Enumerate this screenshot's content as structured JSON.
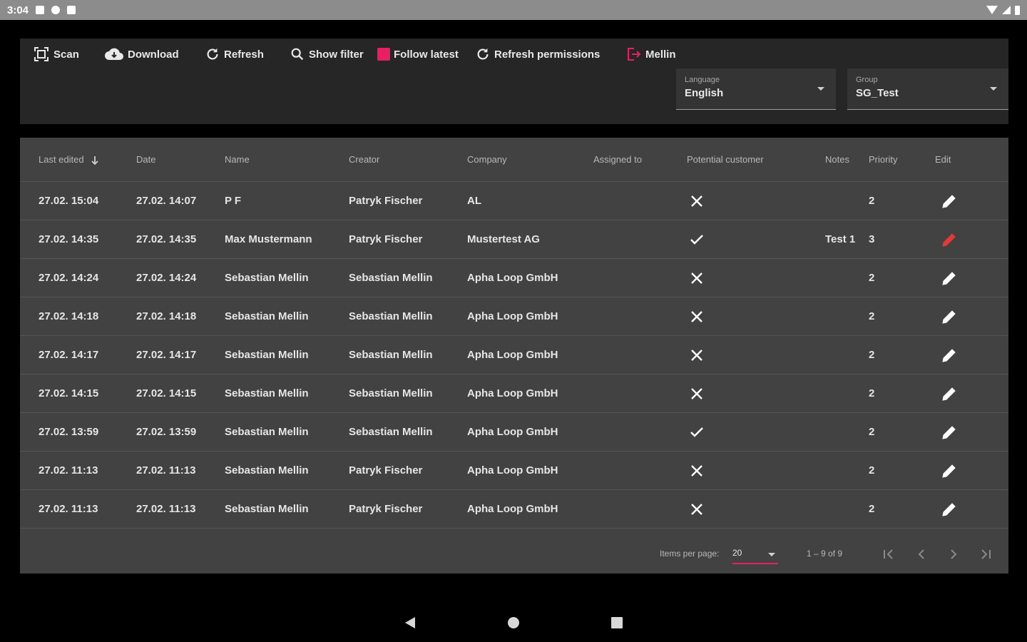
{
  "status_bar": {
    "time": "3:04"
  },
  "toolbar": {
    "scan": "Scan",
    "download": "Download",
    "refresh": "Refresh",
    "show_filter": "Show filter",
    "follow_latest": "Follow latest",
    "refresh_permissions": "Refresh permissions",
    "user": "Mellin",
    "language": {
      "label": "Language",
      "value": "English"
    },
    "group": {
      "label": "Group",
      "value": "SG_Test"
    }
  },
  "table": {
    "headers": {
      "last_edited": "Last edited",
      "date": "Date",
      "name": "Name",
      "creator": "Creator",
      "company": "Company",
      "assigned_to": "Assigned to",
      "potential_customer": "Potential customer",
      "notes": "Notes",
      "priority": "Priority",
      "edit": "Edit"
    },
    "rows": [
      {
        "last_edited": "27.02. 15:04",
        "date": "27.02. 14:07",
        "name": "P F",
        "creator": "Patryk Fischer",
        "company": "AL",
        "assigned_to": "",
        "potential_customer": "no",
        "notes": "",
        "priority": "2",
        "edit_color": "#ffffff"
      },
      {
        "last_edited": "27.02. 14:35",
        "date": "27.02. 14:35",
        "name": "Max Mustermann",
        "creator": "Patryk Fischer",
        "company": "Mustertest AG",
        "assigned_to": "",
        "potential_customer": "yes",
        "notes": "Test 1",
        "priority": "3",
        "edit_color": "#e53935"
      },
      {
        "last_edited": "27.02. 14:24",
        "date": "27.02. 14:24",
        "name": "Sebastian Mellin",
        "creator": "Sebastian Mellin",
        "company": "Apha Loop GmbH",
        "assigned_to": "",
        "potential_customer": "no",
        "notes": "",
        "priority": "2",
        "edit_color": "#ffffff"
      },
      {
        "last_edited": "27.02. 14:18",
        "date": "27.02. 14:18",
        "name": "Sebastian Mellin",
        "creator": "Sebastian Mellin",
        "company": "Apha Loop GmbH",
        "assigned_to": "",
        "potential_customer": "no",
        "notes": "",
        "priority": "2",
        "edit_color": "#ffffff"
      },
      {
        "last_edited": "27.02. 14:17",
        "date": "27.02. 14:17",
        "name": "Sebastian Mellin",
        "creator": "Sebastian Mellin",
        "company": "Apha Loop GmbH",
        "assigned_to": "",
        "potential_customer": "no",
        "notes": "",
        "priority": "2",
        "edit_color": "#ffffff"
      },
      {
        "last_edited": "27.02. 14:15",
        "date": "27.02. 14:15",
        "name": "Sebastian Mellin",
        "creator": "Sebastian Mellin",
        "company": "Apha Loop GmbH",
        "assigned_to": "",
        "potential_customer": "no",
        "notes": "",
        "priority": "2",
        "edit_color": "#ffffff"
      },
      {
        "last_edited": "27.02. 13:59",
        "date": "27.02. 13:59",
        "name": "Sebastian Mellin",
        "creator": "Sebastian Mellin",
        "company": "Apha Loop GmbH",
        "assigned_to": "",
        "potential_customer": "yes",
        "notes": "",
        "priority": "2",
        "edit_color": "#ffffff"
      },
      {
        "last_edited": "27.02. 11:13",
        "date": "27.02. 11:13",
        "name": "Sebastian Mellin",
        "creator": "Patryk Fischer",
        "company": "Apha Loop GmbH",
        "assigned_to": "",
        "potential_customer": "no",
        "notes": "",
        "priority": "2",
        "edit_color": "#ffffff"
      },
      {
        "last_edited": "27.02. 11:13",
        "date": "27.02. 11:13",
        "name": "Sebastian Mellin",
        "creator": "Patryk Fischer",
        "company": "Apha Loop GmbH",
        "assigned_to": "",
        "potential_customer": "no",
        "notes": "",
        "priority": "2",
        "edit_color": "#ffffff"
      }
    ]
  },
  "paginator": {
    "items_per_page_label": "Items per page:",
    "items_per_page": "20",
    "range": "1 – 9 of 9"
  },
  "colors": {
    "accent": "#e91e63",
    "edit_highlight": "#e53935",
    "toolbar_bg": "#262626",
    "table_bg": "#424242"
  },
  "icons": {
    "scan": "scan-icon",
    "download": "cloud-download-icon",
    "refresh": "refresh-icon",
    "search": "search-icon",
    "logout": "logout-icon",
    "edit": "pencil-icon",
    "yes": "check-icon",
    "no": "close-icon"
  }
}
